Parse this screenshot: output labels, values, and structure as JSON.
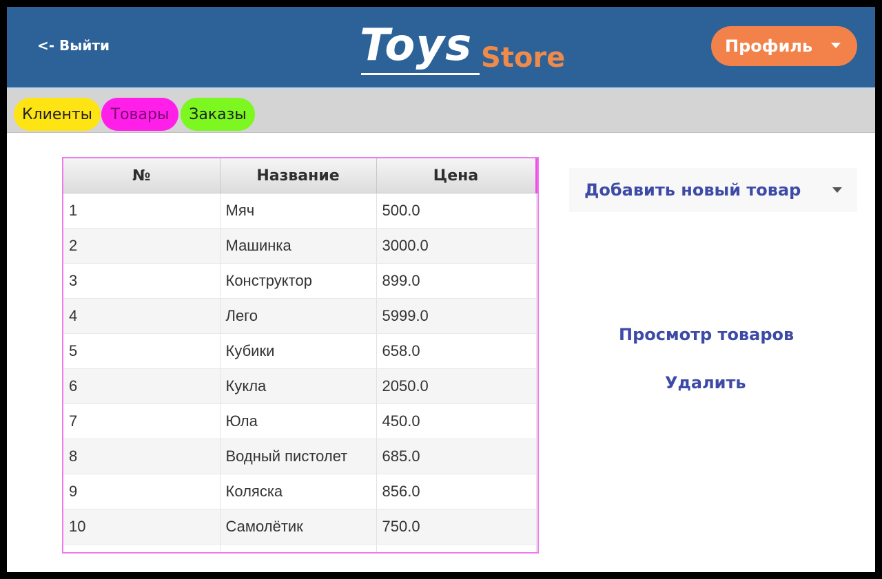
{
  "header": {
    "logout_label": "<- Выйти",
    "logo_toys": "Toys",
    "logo_store": "Store",
    "profile_label": "Профиль"
  },
  "tabs": [
    {
      "label": "Клиенты",
      "color": "#ffe414"
    },
    {
      "label": "Товары",
      "color": "#ff1fe9"
    },
    {
      "label": "Заказы",
      "color": "#7cf71f"
    }
  ],
  "table": {
    "columns": [
      "№",
      "Название",
      "Цена"
    ],
    "rows": [
      [
        "1",
        "Мяч",
        "500.0"
      ],
      [
        "2",
        "Машинка",
        "3000.0"
      ],
      [
        "3",
        "Конструктор",
        "899.0"
      ],
      [
        "4",
        "Лего",
        "5999.0"
      ],
      [
        "5",
        "Кубики",
        "658.0"
      ],
      [
        "6",
        "Кукла",
        "2050.0"
      ],
      [
        "7",
        "Юла",
        "450.0"
      ],
      [
        "8",
        "Водный пистолет",
        "685.0"
      ],
      [
        "9",
        "Коляска",
        "856.0"
      ],
      [
        "10",
        "Самолётик",
        "750.0"
      ]
    ]
  },
  "actions": {
    "add_new_label": "Добавить новый товар",
    "view_label": "Просмотр товаров",
    "delete_label": "Удалить"
  },
  "colors": {
    "header_bg": "#2c6297",
    "accent_orange": "#f2824a",
    "link_blue": "#3d4ba6",
    "table_border": "#ee7bee"
  }
}
